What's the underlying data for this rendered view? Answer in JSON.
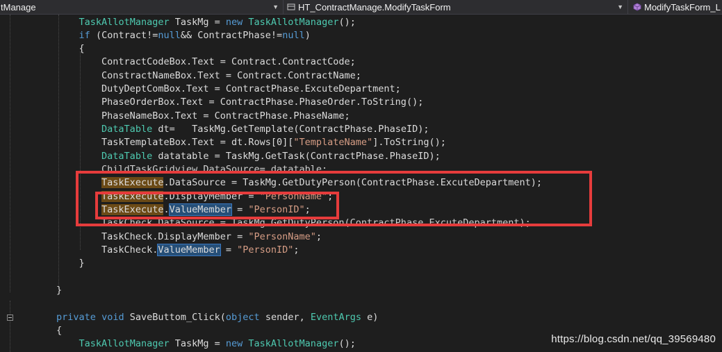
{
  "navigation_bar": {
    "project_dropdown": "tManage",
    "class_dropdown": "HT_ContractManage.ModifyTaskForm",
    "member_dropdown": "ModifyTaskForm_L"
  },
  "code_lines": [
    {
      "segments": [
        {
          "t": "            "
        },
        {
          "t": "TaskAllotManager",
          "c": "type"
        },
        {
          "t": " TaskMg = "
        },
        {
          "t": "new",
          "c": "kw"
        },
        {
          "t": " "
        },
        {
          "t": "TaskAllotManager",
          "c": "type"
        },
        {
          "t": "();"
        }
      ]
    },
    {
      "segments": [
        {
          "t": "            "
        },
        {
          "t": "if",
          "c": "kw"
        },
        {
          "t": " (Contract!="
        },
        {
          "t": "null",
          "c": "kw"
        },
        {
          "t": "&& ContractPhase!="
        },
        {
          "t": "null",
          "c": "kw"
        },
        {
          "t": ")"
        }
      ]
    },
    {
      "segments": [
        {
          "t": "            {"
        }
      ]
    },
    {
      "segments": [
        {
          "t": "                ContractCodeBox.Text = Contract.ContractCode;"
        }
      ]
    },
    {
      "segments": [
        {
          "t": "                ConstractNameBox.Text = Contract.ContractName;"
        }
      ]
    },
    {
      "segments": [
        {
          "t": "                DutyDeptComBox.Text = ContractPhase.ExcuteDepartment;"
        }
      ]
    },
    {
      "segments": [
        {
          "t": "                PhaseOrderBox.Text = ContractPhase.PhaseOrder.ToString();"
        }
      ]
    },
    {
      "segments": [
        {
          "t": "                PhaseNameBox.Text = ContractPhase.PhaseName;"
        }
      ]
    },
    {
      "segments": [
        {
          "t": "                "
        },
        {
          "t": "DataTable",
          "c": "type"
        },
        {
          "t": " dt=   TaskMg.GetTemplate(ContractPhase.PhaseID);"
        }
      ]
    },
    {
      "segments": [
        {
          "t": "                TaskTemplateBox.Text = dt.Rows[0]["
        },
        {
          "t": "\"TemplateName\"",
          "c": "str"
        },
        {
          "t": "].ToString();"
        }
      ]
    },
    {
      "segments": [
        {
          "t": "                "
        },
        {
          "t": "DataTable",
          "c": "type"
        },
        {
          "t": " datatable = TaskMg.GetTask(ContractPhase.PhaseID);"
        }
      ]
    },
    {
      "segments": [
        {
          "t": "                ChildTaskGridview.DataSource= datatable;"
        }
      ],
      "partially_obscured": true
    },
    {
      "segments": [
        {
          "t": "                "
        },
        {
          "t": "TaskExecute",
          "h": "ref"
        },
        {
          "t": ".DataSource = TaskMg.GetDutyPerson(ContractPhase.ExcuteDepartment);"
        }
      ]
    },
    {
      "segments": [
        {
          "t": "                "
        },
        {
          "t": "TaskExecute",
          "h": "ref"
        },
        {
          "t": ".DisplayMember = "
        },
        {
          "t": "\"PersonName\"",
          "c": "str"
        },
        {
          "t": ";"
        }
      ]
    },
    {
      "segments": [
        {
          "t": "                "
        },
        {
          "t": "TaskExecute",
          "h": "ref"
        },
        {
          "t": "."
        },
        {
          "t": "ValueMember",
          "h": "sel"
        },
        {
          "t": " = "
        },
        {
          "t": "\"PersonID\"",
          "c": "str"
        },
        {
          "t": ";"
        }
      ]
    },
    {
      "segments": [
        {
          "t": "                TaskCheck.DataSource = TaskMg.GetDutyPerson(ContractPhase.ExcuteDepartment);"
        }
      ],
      "partially_obscured": true
    },
    {
      "segments": [
        {
          "t": "                TaskCheck.DisplayMember = "
        },
        {
          "t": "\"PersonName\"",
          "c": "str"
        },
        {
          "t": ";"
        }
      ]
    },
    {
      "segments": [
        {
          "t": "                TaskCheck."
        },
        {
          "t": "ValueMember",
          "h": "sel"
        },
        {
          "t": " = "
        },
        {
          "t": "\"PersonID\"",
          "c": "str"
        },
        {
          "t": ";"
        }
      ]
    },
    {
      "segments": [
        {
          "t": "            }"
        }
      ]
    },
    {
      "segments": [
        {
          "t": ""
        }
      ]
    },
    {
      "segments": [
        {
          "t": "        }"
        }
      ]
    },
    {
      "segments": [
        {
          "t": ""
        }
      ]
    },
    {
      "segments": [
        {
          "t": "        "
        },
        {
          "t": "private",
          "c": "kw"
        },
        {
          "t": " "
        },
        {
          "t": "void",
          "c": "kw"
        },
        {
          "t": " SaveButtom_Click("
        },
        {
          "t": "object",
          "c": "kw"
        },
        {
          "t": " sender, "
        },
        {
          "t": "EventArgs",
          "c": "type"
        },
        {
          "t": " e)"
        }
      ]
    },
    {
      "segments": [
        {
          "t": "        {"
        }
      ]
    },
    {
      "segments": [
        {
          "t": "            "
        },
        {
          "t": "TaskAllotManager",
          "c": "type"
        },
        {
          "t": " TaskMg = "
        },
        {
          "t": "new",
          "c": "kw"
        },
        {
          "t": " "
        },
        {
          "t": "TaskAllotManager",
          "c": "type"
        },
        {
          "t": "();"
        }
      ]
    }
  ],
  "watermark": "https://blog.csdn.net/qq_39569480",
  "colors": {
    "editor_background": "#1e1e1e",
    "type_name": "#4ec9b0",
    "keyword": "#569cd6",
    "string": "#d69d85",
    "plain_text": "#dcdcdc",
    "reference_highlight": "#6b4a16",
    "selection_highlight": "#264f78",
    "annotation_box": "#e63c3c"
  },
  "icons": {
    "member_dropdown_icon": "purple-cube-member-icon",
    "dropdown_arrows": "chevron-down-icon"
  }
}
